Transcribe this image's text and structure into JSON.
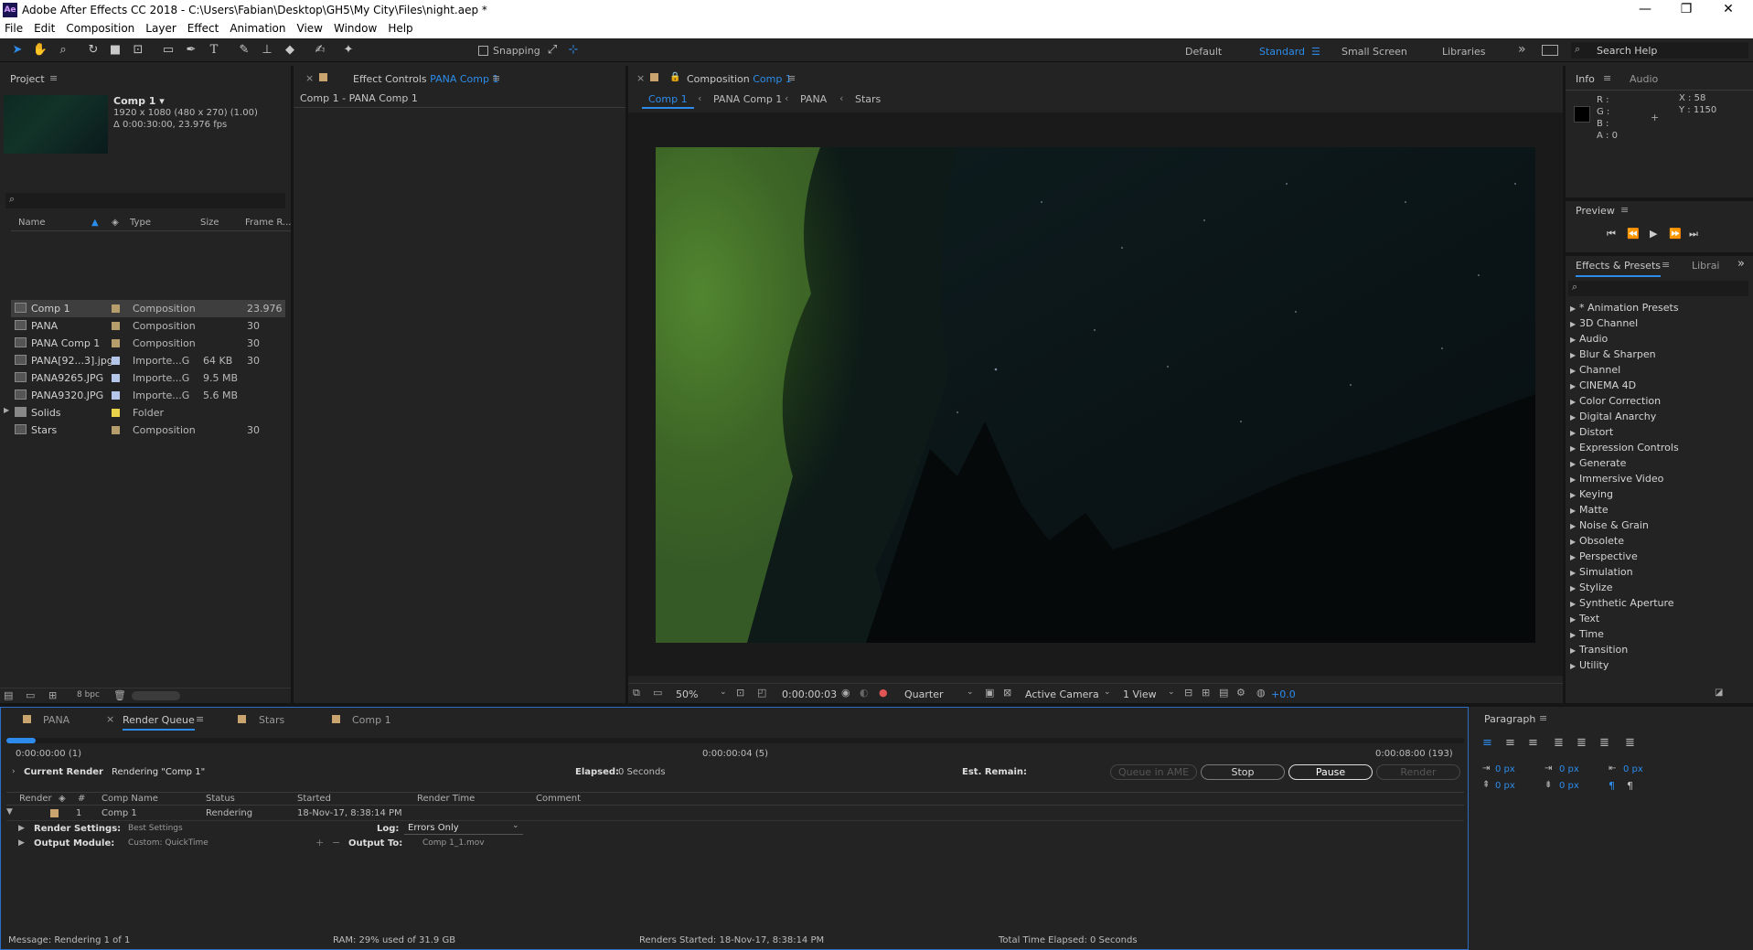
{
  "window": {
    "title": "Adobe After Effects CC 2018 - C:\\Users\\Fabian\\Desktop\\GH5\\My City\\Files\\night.aep *",
    "logo": "Ae",
    "minimize": "—",
    "maximize": "❐",
    "close": "✕"
  },
  "menu": [
    "File",
    "Edit",
    "Composition",
    "Layer",
    "Effect",
    "Animation",
    "View",
    "Window",
    "Help"
  ],
  "toolbar": {
    "snapping": "Snapping",
    "workspaces": {
      "default": "Default",
      "standard": "Standard",
      "small": "Small Screen",
      "libraries": "Libraries"
    },
    "search_help": "Search Help"
  },
  "project": {
    "tab": "Project",
    "comp_name": "Comp 1 ▾",
    "comp_res": "1920 x 1080  (480 x 270) (1.00)",
    "comp_dur": "Δ 0:00:30:00, 23.976 fps",
    "columns": {
      "name": "Name",
      "type": "Type",
      "size": "Size",
      "frame": "Frame R..."
    },
    "items": [
      {
        "name": "Comp 1",
        "type": "Composition",
        "size": "",
        "frame": "23.976",
        "label_color": "#b59e6b"
      },
      {
        "name": "PANA",
        "type": "Composition",
        "size": "",
        "frame": "30",
        "label_color": "#b59e6b"
      },
      {
        "name": "PANA Comp 1",
        "type": "Composition",
        "size": "",
        "frame": "30",
        "label_color": "#b59e6b"
      },
      {
        "name": "PANA[92...3].jpg",
        "type": "Importe...G",
        "size": "64 KB",
        "frame": "30",
        "label_color": "#b6c6e8"
      },
      {
        "name": "PANA9265.JPG",
        "type": "Importe...G",
        "size": "9.5 MB",
        "frame": "",
        "label_color": "#b6c6e8"
      },
      {
        "name": "PANA9320.JPG",
        "type": "Importe...G",
        "size": "5.6 MB",
        "frame": "",
        "label_color": "#b6c6e8"
      },
      {
        "name": "Solids",
        "type": "Folder",
        "size": "",
        "frame": "",
        "label_color": "#e8d24a"
      },
      {
        "name": "Stars",
        "type": "Composition",
        "size": "",
        "frame": "30",
        "label_color": "#b59e6b"
      }
    ],
    "bpc": "8 bpc"
  },
  "effect_controls": {
    "tab_prefix": "Effect Controls",
    "tab_target": "PANA Comp 1",
    "subtitle": "Comp 1 - PANA Comp 1"
  },
  "composition": {
    "tab_prefix": "Composition",
    "tab_target": "Comp 1",
    "breadcrumbs": [
      "Comp 1",
      "PANA Comp 1",
      "PANA",
      "Stars"
    ],
    "footer": {
      "zoom": "50%",
      "timecode": "0:00:00:03",
      "resolution": "Quarter",
      "camera": "Active Camera",
      "views": "1 View",
      "exposure": "+0.0"
    }
  },
  "info": {
    "tabs": [
      "Info",
      "Audio"
    ],
    "r": "R :",
    "g": "G :",
    "b": "B :",
    "a": "A : 0",
    "x": "X : 58",
    "y": "Y : 1150"
  },
  "preview": {
    "tab": "Preview"
  },
  "effects": {
    "tabs": [
      "Effects & Presets",
      "Librai"
    ],
    "categories": [
      "* Animation Presets",
      "3D Channel",
      "Audio",
      "Blur & Sharpen",
      "Channel",
      "CINEMA 4D",
      "Color Correction",
      "Digital Anarchy",
      "Distort",
      "Expression Controls",
      "Generate",
      "Immersive Video",
      "Keying",
      "Matte",
      "Noise & Grain",
      "Obsolete",
      "Perspective",
      "Simulation",
      "Stylize",
      "Synthetic Aperture",
      "Text",
      "Time",
      "Transition",
      "Utility"
    ]
  },
  "bottom_tabs": [
    "PANA",
    "Render Queue",
    "Stars",
    "Comp 1"
  ],
  "render": {
    "progress": 0.02,
    "time_start": "0:00:00:00 (1)",
    "time_mid": "0:00:00:04 (5)",
    "time_end": "0:00:08:00 (193)",
    "current_render": "Current Render",
    "rendering": "Rendering \"Comp 1\"",
    "elapsed_label": "Elapsed:",
    "elapsed": "0 Seconds",
    "remain_label": "Est. Remain:",
    "buttons": {
      "ame": "Queue in AME",
      "stop": "Stop",
      "pause": "Pause",
      "render": "Render"
    },
    "columns": {
      "render": "Render",
      "num": "#",
      "comp": "Comp Name",
      "status": "Status",
      "started": "Started",
      "time": "Render Time",
      "comment": "Comment"
    },
    "item": {
      "num": "1",
      "comp": "Comp 1",
      "status": "Rendering",
      "started": "18-Nov-17, 8:38:14 PM"
    },
    "settings_label": "Render Settings:",
    "settings_value": "Best Settings",
    "log_label": "Log:",
    "log_value": "Errors Only",
    "output_label": "Output Module:",
    "output_value": "Custom: QuickTime",
    "output_to_label": "Output To:",
    "output_to_value": "Comp 1_1.mov",
    "status": {
      "message": "Message:  Rendering 1 of 1",
      "ram": "RAM:  29% used of 31.9 GB",
      "renders_started": "Renders Started:  18-Nov-17, 8:38:14 PM",
      "total_elapsed": "Total Time Elapsed:  0 Seconds"
    }
  },
  "paragraph": {
    "tab": "Paragraph",
    "indent_left": "0 px",
    "indent_first": "0 px",
    "indent_right": "0 px",
    "space_before": "0 px",
    "space_after": "0 px"
  }
}
